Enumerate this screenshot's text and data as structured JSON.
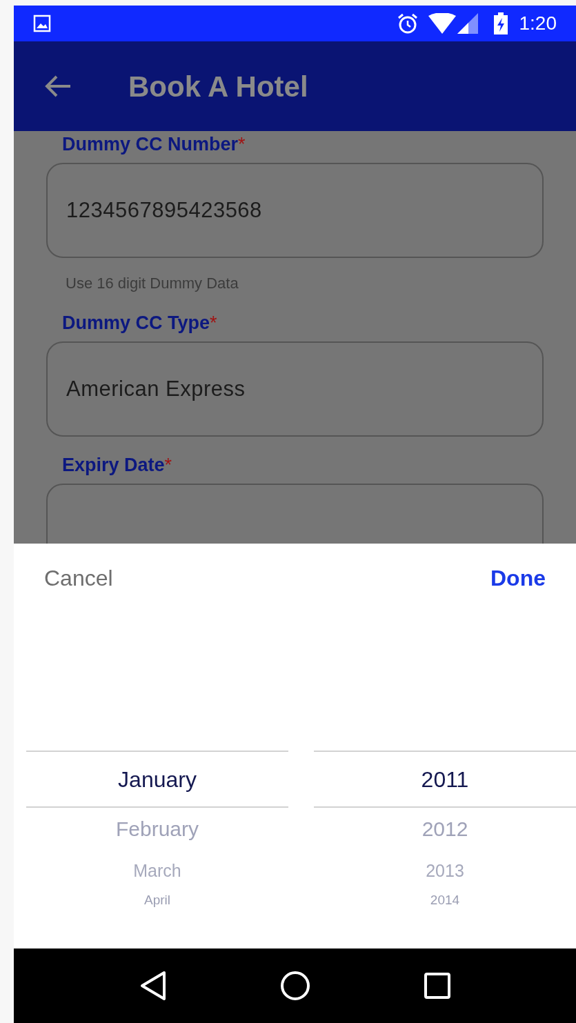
{
  "status_bar": {
    "time": "1:20"
  },
  "app_bar": {
    "title": "Book A Hotel"
  },
  "form": {
    "fields": [
      {
        "label": "Dummy CC Number",
        "required_mark": "*",
        "value": "1234567895423568",
        "hint": "Use 16 digit Dummy Data"
      },
      {
        "label": "Dummy CC Type",
        "required_mark": "*",
        "value": "American Express"
      },
      {
        "label": "Expiry Date",
        "required_mark": "*"
      }
    ]
  },
  "picker": {
    "cancel": "Cancel",
    "done": "Done",
    "columns": [
      {
        "items": [
          {
            "label": "January",
            "selected": true
          },
          {
            "label": "February",
            "selected": false
          },
          {
            "label": "March",
            "selected": false
          },
          {
            "label": "April",
            "selected": false
          }
        ]
      },
      {
        "items": [
          {
            "label": "2011",
            "selected": true
          },
          {
            "label": "2012",
            "selected": false
          },
          {
            "label": "2013",
            "selected": false
          },
          {
            "label": "2014",
            "selected": false
          }
        ]
      }
    ]
  }
}
